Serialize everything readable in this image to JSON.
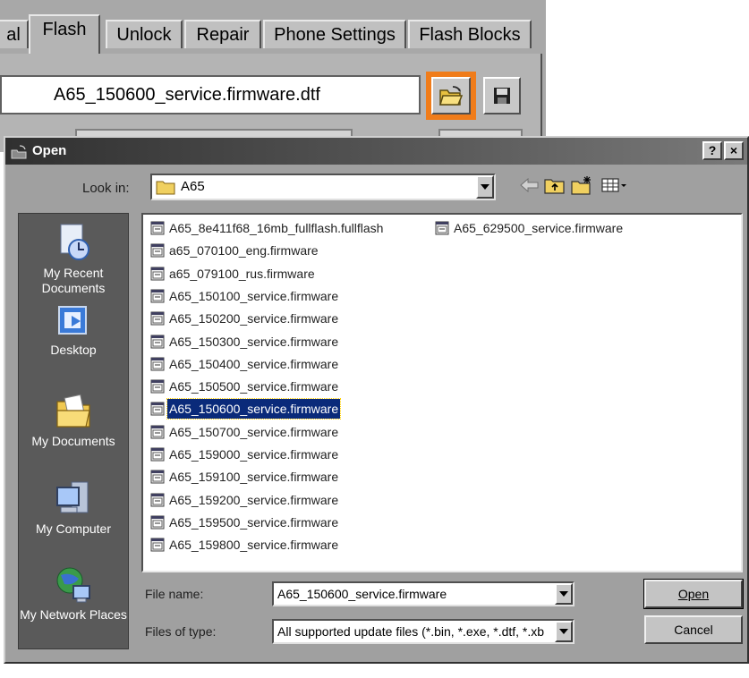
{
  "app": {
    "tabs": [
      "al",
      "Flash",
      "Unlock",
      "Repair",
      "Phone Settings",
      "Flash Blocks"
    ],
    "active_tab": "Flash",
    "firmware_path": "A65_150600_service.firmware.dtf",
    "open_button_icon": "open-folder-icon",
    "save_button_icon": "floppy-disk-icon",
    "highlight_color": "#f07c1a"
  },
  "dialog": {
    "title": "Open",
    "help_label": "?",
    "close_label": "×",
    "look_in_label": "Look in:",
    "look_in_value": "A65",
    "places": [
      {
        "label": "My Recent Documents",
        "icon": "recent-documents-icon"
      },
      {
        "label": "Desktop",
        "icon": "desktop-icon"
      },
      {
        "label": "My Documents",
        "icon": "my-documents-icon"
      },
      {
        "label": "My Computer",
        "icon": "my-computer-icon"
      },
      {
        "label": "My Network Places",
        "icon": "network-places-icon"
      }
    ],
    "files": [
      "A65_8e411f68_16mb_fullflash.fullflash",
      "a65_070100_eng.firmware",
      "a65_079100_rus.firmware",
      "A65_150100_service.firmware",
      "A65_150200_service.firmware",
      "A65_150300_service.firmware",
      "A65_150400_service.firmware",
      "A65_150500_service.firmware",
      "A65_150600_service.firmware",
      "A65_150700_service.firmware",
      "A65_159000_service.firmware",
      "A65_159100_service.firmware",
      "A65_159200_service.firmware",
      "A65_159500_service.firmware",
      "A65_159800_service.firmware",
      "A65_629500_service.firmware"
    ],
    "selected_file": "A65_150600_service.firmware",
    "file_name_label": "File name:",
    "file_name_value": "A65_150600_service.firmware",
    "files_of_type_label": "Files of type:",
    "files_of_type_value": "All supported update files (*.bin, *.exe, *.dtf, *.xb",
    "open_button": "Open",
    "cancel_button": "Cancel",
    "selection_color": "#0a2a7a"
  }
}
